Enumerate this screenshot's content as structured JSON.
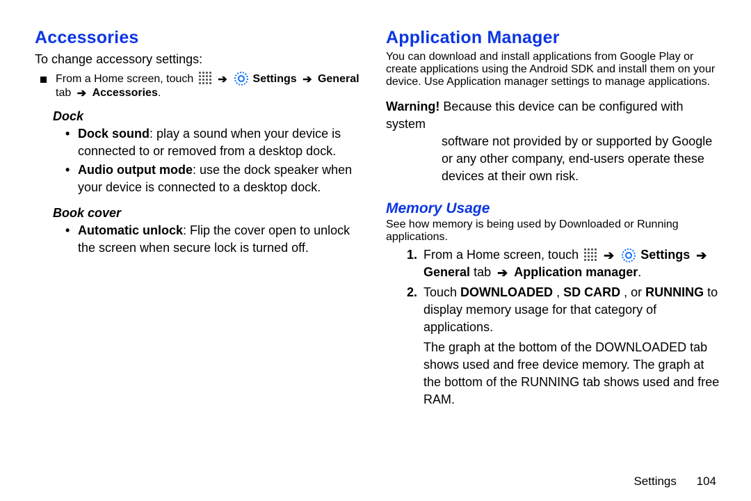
{
  "left": {
    "heading": "Accessories",
    "intro": "To change accessory settings:",
    "nav": {
      "pre": "From a Home screen, touch ",
      "settings": "Settings",
      "general_tab": "General",
      "tab_word": "tab",
      "target": "Accessories",
      "period": "."
    },
    "dock": {
      "head": "Dock",
      "items": [
        {
          "lead": "Dock sound",
          "rest": ": play a sound when your device is connected to or removed from a desktop dock."
        },
        {
          "lead": "Audio output mode",
          "rest": ": use the dock speaker when your device is connected to a desktop dock."
        }
      ]
    },
    "bookcover": {
      "head": "Book cover",
      "items": [
        {
          "lead": "Automatic unlock",
          "rest": ": Flip the cover open to unlock the screen when secure lock is turned off."
        }
      ]
    }
  },
  "right": {
    "heading": "Application Manager",
    "intro": "You can download and install applications from Google Play or create applications using the Android SDK and install them on your device. Use Application manager settings to manage applications.",
    "warning": {
      "label": "Warning!",
      "body": "Because this device can be configured with system software not provided by or supported by Google or any other company, end-users operate these devices at their own risk."
    },
    "memory": {
      "head": "Memory Usage",
      "intro": "See how memory is being used by Downloaded or Running applications.",
      "nav": {
        "pre": "From a Home screen, touch ",
        "settings": "Settings",
        "general_tab": "General",
        "tab_word": "tab",
        "target": "Application manager",
        "period": "."
      },
      "step2": {
        "pre": "Touch ",
        "a": "DOWNLOADED",
        "sep1": ", ",
        "b": "SD CARD",
        "sep2": ", or ",
        "c": "RUNNING",
        "post": " to display memory usage for that category of applications."
      },
      "note": "The graph at the bottom of the DOWNLOADED tab shows used and free device memory. The graph at the bottom of the RUNNING tab shows used and free RAM."
    }
  },
  "footer": {
    "label": "Settings",
    "page": "104"
  },
  "glyphs": {
    "arrow": "➔"
  }
}
